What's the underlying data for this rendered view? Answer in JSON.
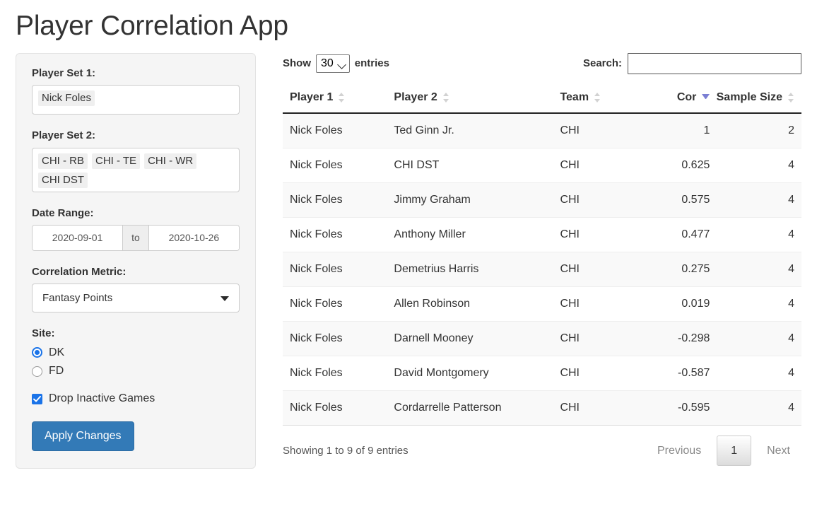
{
  "header": {
    "title": "Player Correlation App"
  },
  "sidebar": {
    "player_set_1": {
      "label": "Player Set 1:",
      "tokens": [
        "Nick Foles"
      ]
    },
    "player_set_2": {
      "label": "Player Set 2:",
      "tokens": [
        "CHI - RB",
        "CHI - TE",
        "CHI - WR",
        "CHI DST"
      ]
    },
    "date_range": {
      "label": "Date Range:",
      "start": "2020-09-01",
      "separator": "to",
      "end": "2020-10-26"
    },
    "correlation_metric": {
      "label": "Correlation Metric:",
      "selected": "Fantasy Points"
    },
    "site": {
      "label": "Site:",
      "options": [
        {
          "label": "DK",
          "checked": true
        },
        {
          "label": "FD",
          "checked": false
        }
      ]
    },
    "drop_inactive": {
      "label": "Drop Inactive Games",
      "checked": true
    },
    "apply_button": "Apply Changes"
  },
  "table_controls": {
    "show_label": "Show",
    "entries_label": "entries",
    "page_length": "30",
    "search_label": "Search:",
    "search_value": "",
    "search_placeholder": ""
  },
  "table": {
    "columns": [
      {
        "label": "Player 1",
        "sort": "both",
        "align": "left"
      },
      {
        "label": "Player 2",
        "sort": "both",
        "align": "left"
      },
      {
        "label": "Team",
        "sort": "both",
        "align": "left"
      },
      {
        "label": "Cor",
        "sort": "desc",
        "align": "right"
      },
      {
        "label": "Sample Size",
        "sort": "both",
        "align": "right"
      }
    ],
    "rows": [
      {
        "player1": "Nick Foles",
        "player2": "Ted Ginn Jr.",
        "team": "CHI",
        "cor": "1",
        "sample_size": "2"
      },
      {
        "player1": "Nick Foles",
        "player2": "CHI DST",
        "team": "CHI",
        "cor": "0.625",
        "sample_size": "4"
      },
      {
        "player1": "Nick Foles",
        "player2": "Jimmy Graham",
        "team": "CHI",
        "cor": "0.575",
        "sample_size": "4"
      },
      {
        "player1": "Nick Foles",
        "player2": "Anthony Miller",
        "team": "CHI",
        "cor": "0.477",
        "sample_size": "4"
      },
      {
        "player1": "Nick Foles",
        "player2": "Demetrius Harris",
        "team": "CHI",
        "cor": "0.275",
        "sample_size": "4"
      },
      {
        "player1": "Nick Foles",
        "player2": "Allen Robinson",
        "team": "CHI",
        "cor": "0.019",
        "sample_size": "4"
      },
      {
        "player1": "Nick Foles",
        "player2": "Darnell Mooney",
        "team": "CHI",
        "cor": "-0.298",
        "sample_size": "4"
      },
      {
        "player1": "Nick Foles",
        "player2": "David Montgomery",
        "team": "CHI",
        "cor": "-0.587",
        "sample_size": "4"
      },
      {
        "player1": "Nick Foles",
        "player2": "Cordarrelle Patterson",
        "team": "CHI",
        "cor": "-0.595",
        "sample_size": "4"
      }
    ]
  },
  "footer": {
    "info": "Showing 1 to 9 of 9 entries",
    "previous": "Previous",
    "current_page": "1",
    "next": "Next"
  },
  "colors": {
    "primary_button": "#337ab7",
    "accent_control": "#1a73e8",
    "sort_active": "#7b7fd4",
    "panel_bg": "#f5f5f5",
    "row_stripe": "#f9f9f9"
  }
}
